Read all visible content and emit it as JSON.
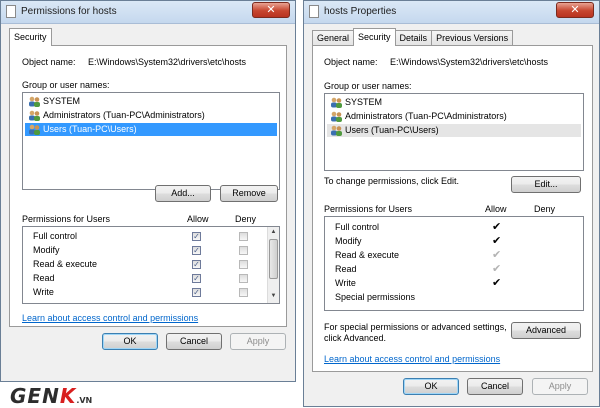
{
  "left_window": {
    "title": "Permissions for hosts",
    "tab": "Security",
    "object_name_label": "Object name:",
    "object_name_value": "E:\\Windows\\System32\\drivers\\etc\\hosts",
    "group_label": "Group or user names:",
    "users": [
      {
        "name": "SYSTEM",
        "selected": false
      },
      {
        "name": "Administrators (Tuan-PC\\Administrators)",
        "selected": false
      },
      {
        "name": "Users (Tuan-PC\\Users)",
        "selected": true
      }
    ],
    "add_button": "Add...",
    "remove_button": "Remove",
    "permissions_label": "Permissions for Users",
    "allow_header": "Allow",
    "deny_header": "Deny",
    "permissions": [
      {
        "name": "Full control",
        "allow": true,
        "deny": false
      },
      {
        "name": "Modify",
        "allow": true,
        "deny": false
      },
      {
        "name": "Read & execute",
        "allow": true,
        "deny": false
      },
      {
        "name": "Read",
        "allow": true,
        "deny": false
      },
      {
        "name": "Write",
        "allow": true,
        "deny": false
      }
    ],
    "link": "Learn about access control and permissions",
    "ok_button": "OK",
    "cancel_button": "Cancel",
    "apply_button": "Apply"
  },
  "right_window": {
    "title": "hosts Properties",
    "tabs": [
      "General",
      "Security",
      "Details",
      "Previous Versions"
    ],
    "active_tab": "Security",
    "object_name_label": "Object name:",
    "object_name_value": "E:\\Windows\\System32\\drivers\\etc\\hosts",
    "group_label": "Group or user names:",
    "users": [
      {
        "name": "SYSTEM"
      },
      {
        "name": "Administrators (Tuan-PC\\Administrators)"
      },
      {
        "name": "Users (Tuan-PC\\Users)"
      }
    ],
    "change_text": "To change permissions, click Edit.",
    "edit_button": "Edit...",
    "permissions_label": "Permissions for Users",
    "allow_header": "Allow",
    "deny_header": "Deny",
    "permissions": [
      {
        "name": "Full control",
        "allow": "check"
      },
      {
        "name": "Modify",
        "allow": "check"
      },
      {
        "name": "Read & execute",
        "allow": "grey"
      },
      {
        "name": "Read",
        "allow": "grey"
      },
      {
        "name": "Write",
        "allow": "check"
      },
      {
        "name": "Special permissions",
        "allow": "none"
      }
    ],
    "special_text_line1": "For special permissions or advanced settings,",
    "special_text_line2": "click Advanced.",
    "advanced_button": "Advanced",
    "link": "Learn about access control and permissions",
    "ok_button": "OK",
    "cancel_button": "Cancel",
    "apply_button": "Apply"
  },
  "watermark": {
    "main": "GEN",
    "accent": "K",
    "suffix": ".VN"
  },
  "icons": {
    "close": "close-icon",
    "user": "user-group-icon",
    "file": "file-icon"
  },
  "colors": {
    "selection": "#3399ff",
    "link": "#0066cc",
    "titlebar": "#c5d8ee",
    "close": "#c7452f"
  }
}
